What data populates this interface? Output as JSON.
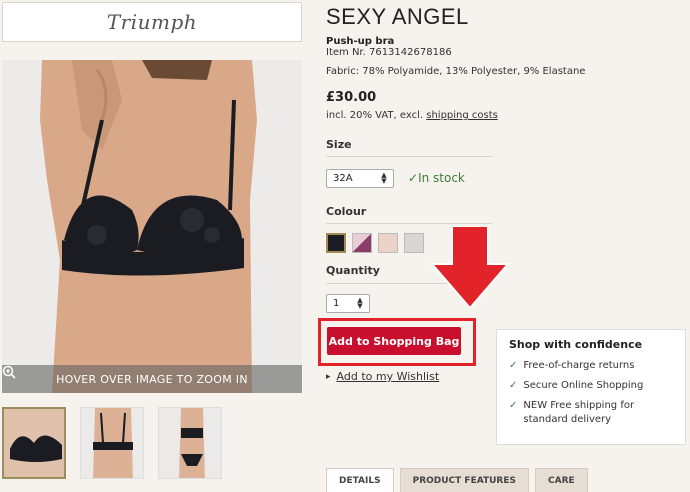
{
  "brand": {
    "logo_text": "Triumph"
  },
  "product": {
    "title": "SEXY ANGEL",
    "subtitle": "Push-up bra",
    "item_nr": "Item Nr. 7613142678186",
    "fabric": "Fabric: 78% Polyamide, 13% Polyester, 9% Elastane",
    "price": "£30.00",
    "vat_text": "incl. 20% VAT, excl. ",
    "shipping_link": "shipping costs"
  },
  "image": {
    "zoom_hint": "HOVER OVER IMAGE TO ZOOM IN"
  },
  "size": {
    "label": "Size",
    "selected": "32A",
    "stock": "In stock"
  },
  "colour": {
    "label": "Colour",
    "swatches": [
      "#1c1c22",
      "#d8b7c2",
      "#ecd3c8",
      "#d9d7d4"
    ]
  },
  "quantity": {
    "label": "Quantity",
    "value": "1"
  },
  "actions": {
    "add_to_bag": "Add to Shopping Bag",
    "wishlist": "Add to my Wishlist"
  },
  "confidence": {
    "title": "Shop with confidence",
    "items": [
      "Free-of-charge returns",
      "Secure Online Shopping",
      "NEW Free shipping for standard delivery"
    ]
  },
  "tabs": [
    "DETAILS",
    "PRODUCT FEATURES",
    "CARE"
  ],
  "colors": {
    "accent": "#c8102e",
    "highlight": "#e2232a",
    "stock": "#3a7d3a"
  }
}
